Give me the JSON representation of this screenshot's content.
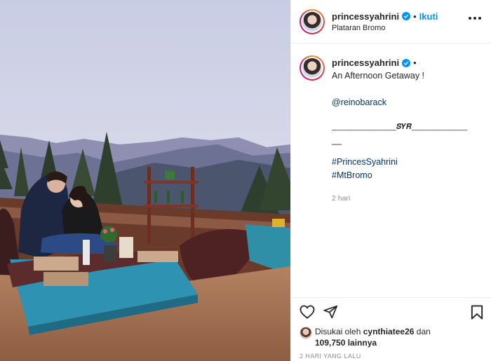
{
  "post": {
    "username": "princessyahrini",
    "follow_label": "Ikuti",
    "location": "Plataran Bromo",
    "more_icon": "more-options-icon",
    "verified_color": "#0095f6"
  },
  "caption": {
    "username": "princessyahrini",
    "title": "An Afternoon Getaway !",
    "mention": "@reinobarack",
    "separator": "_______________𝑺𝒀𝑹_____________",
    "separator_tail": "__",
    "hashtags": [
      "#PrincesSyahrini",
      "#MtBromo"
    ],
    "time_ago": "2 hari"
  },
  "actions": {
    "like_icon": "heart-icon",
    "comment_icon": "comment-icon",
    "share_icon": "share-icon",
    "save_icon": "bookmark-icon"
  },
  "likes": {
    "prefix": "Disukai oleh",
    "liker": "cynthiatee26",
    "and": "dan",
    "count": "109,750 lainnya"
  },
  "date": "2 HARI YANG LALU",
  "colors": {
    "link": "#00376b",
    "follow": "#0095f6",
    "muted": "#8e8e8e"
  }
}
